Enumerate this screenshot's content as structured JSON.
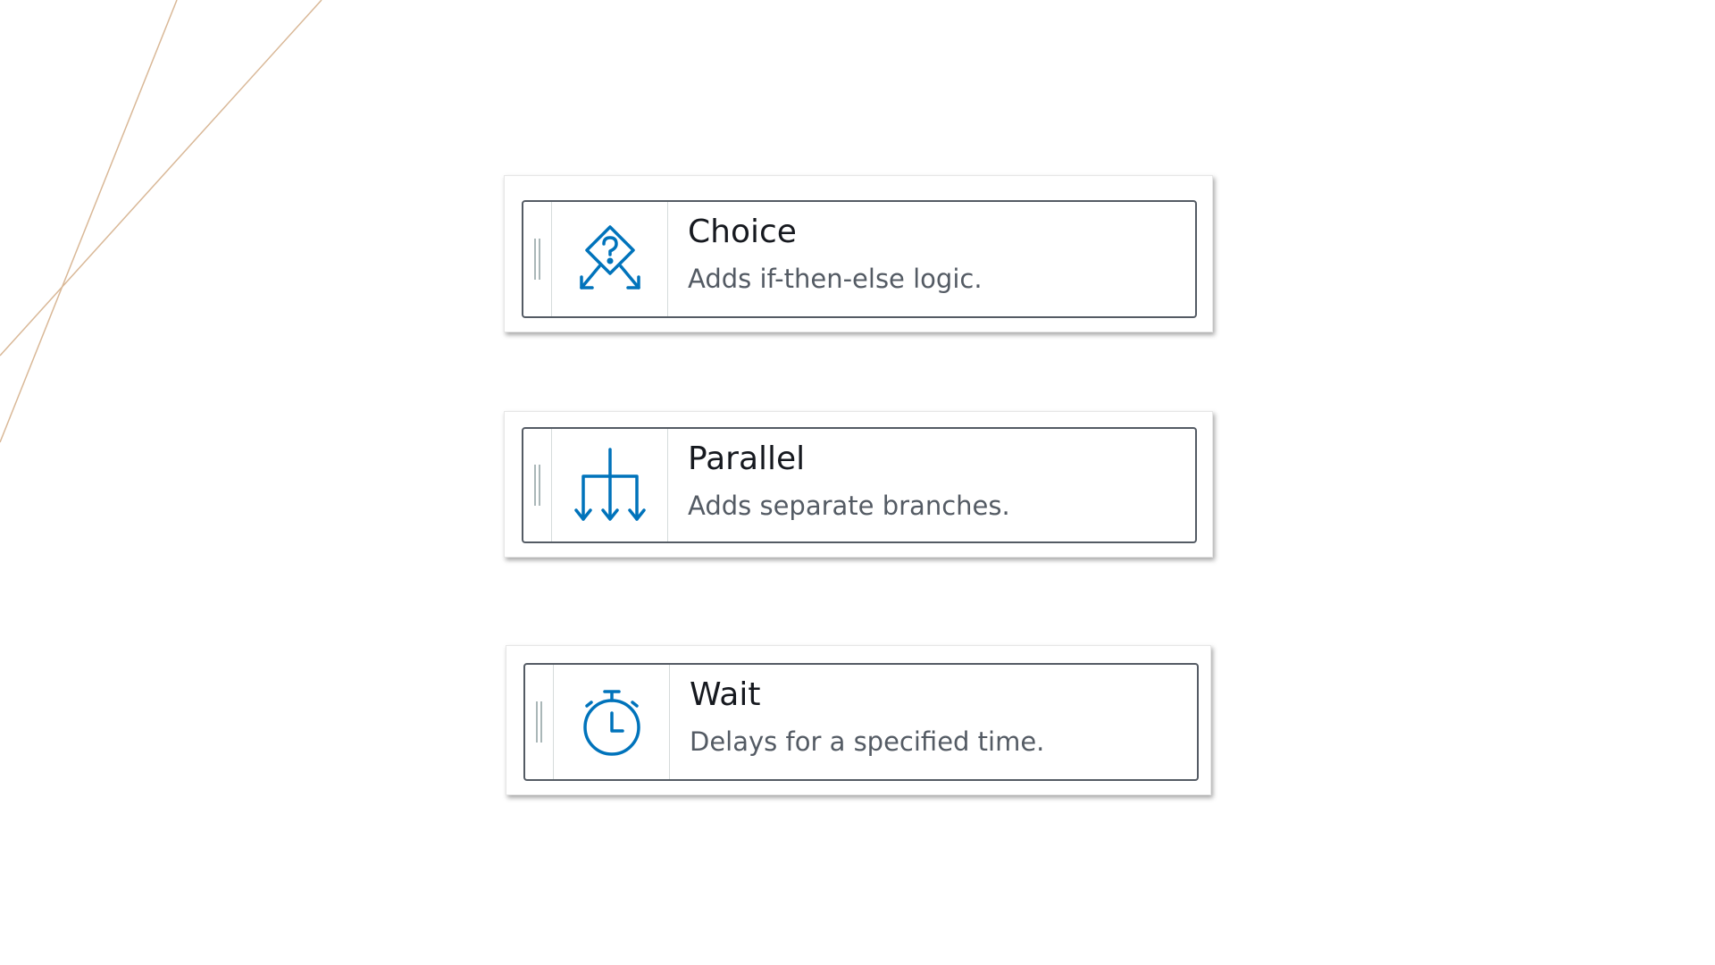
{
  "colors": {
    "icon_blue": "#0073bb",
    "decor_line": "#c9a27a",
    "card_border": "#545b64",
    "title_text": "#16191f",
    "desc_text": "#545b64"
  },
  "states": [
    {
      "title": "Choice",
      "description": "Adds if-then-else logic.",
      "icon": "choice-diamond-question-icon"
    },
    {
      "title": "Parallel",
      "description": "Adds separate branches.",
      "icon": "parallel-branches-icon"
    },
    {
      "title": "Wait",
      "description": "Delays for a specified time.",
      "icon": "stopwatch-icon"
    }
  ]
}
